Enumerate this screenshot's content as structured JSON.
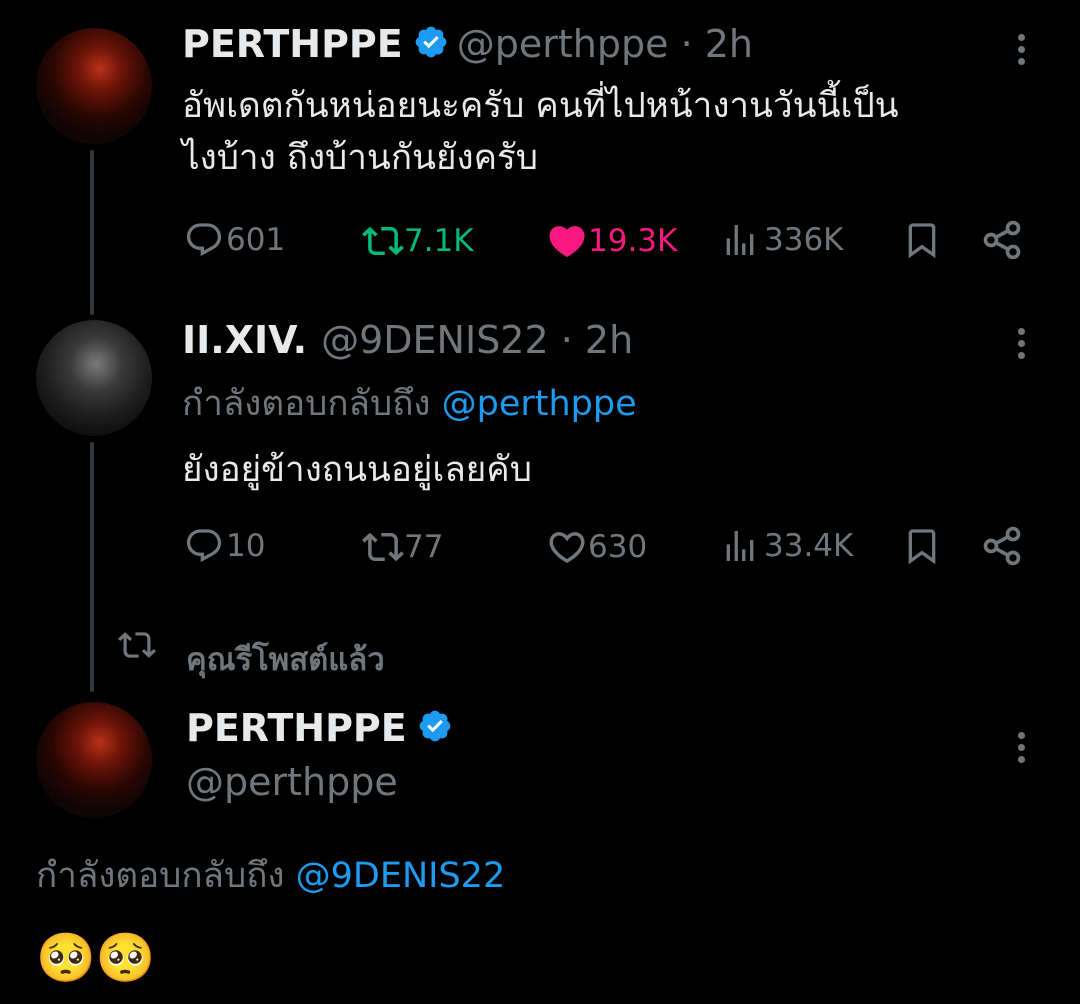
{
  "tweet1": {
    "name": "PERTHPPE",
    "handle": "@perthppe",
    "sep": " · ",
    "time": "2h",
    "text_line1": "อัพเดตกันหน่อยนะครับ คนที่ไปหน้างานวันนี้เป็น",
    "text_line2": "ไงบ้าง ถึงบ้านกันยังครับ",
    "replies": "601",
    "retweets": "7.1K",
    "likes": "19.3K",
    "views": "336K",
    "retweet_color": "#00ba7c",
    "like_color": "#f91880"
  },
  "tweet2": {
    "name": "II.XIV.",
    "handle": "@9DENIS22",
    "sep": " · ",
    "time": "2h",
    "replying_prefix": "กำลังตอบกลับถึง ",
    "replying_to": "@perthppe",
    "text": "ยังอยู่ข้างถนนอยู่เลยคับ",
    "replies": "10",
    "retweets": "77",
    "likes": "630",
    "views": "33.4K"
  },
  "repost_banner": {
    "label": "คุณรีโพสต์แล้ว",
    "icon": "retweet-icon"
  },
  "tweet3": {
    "name": "PERTHPPE",
    "handle": "@perthppe",
    "replying_prefix": "กำลังตอบกลับถึง ",
    "replying_to": "@9DENIS22",
    "emoji": "🥺🥺"
  },
  "colors": {
    "background": "#000000",
    "text": "#e7e9ea",
    "muted": "#71767b",
    "link": "#1d9bf0",
    "verified": "#1d9bf0"
  }
}
